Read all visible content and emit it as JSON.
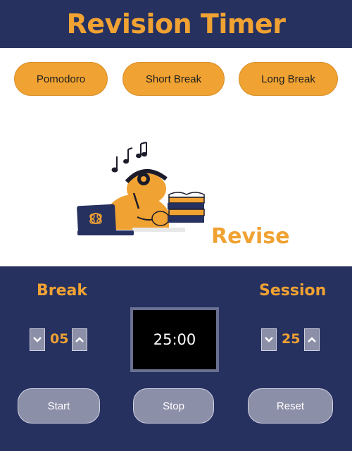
{
  "app": {
    "title": "Revision Timer"
  },
  "modes": [
    {
      "label": "Pomodoro"
    },
    {
      "label": "Short Break"
    },
    {
      "label": "Long Break"
    }
  ],
  "hero": {
    "label": "Revise"
  },
  "break": {
    "label": "Break",
    "value": "05"
  },
  "session": {
    "label": "Session",
    "value": "25"
  },
  "timer": {
    "display": "25:00"
  },
  "controls": {
    "start": "Start",
    "stop": "Stop",
    "reset": "Reset"
  },
  "colors": {
    "navy": "#263160",
    "orange": "#f0a232",
    "button_grey": "#8c8fa8"
  }
}
